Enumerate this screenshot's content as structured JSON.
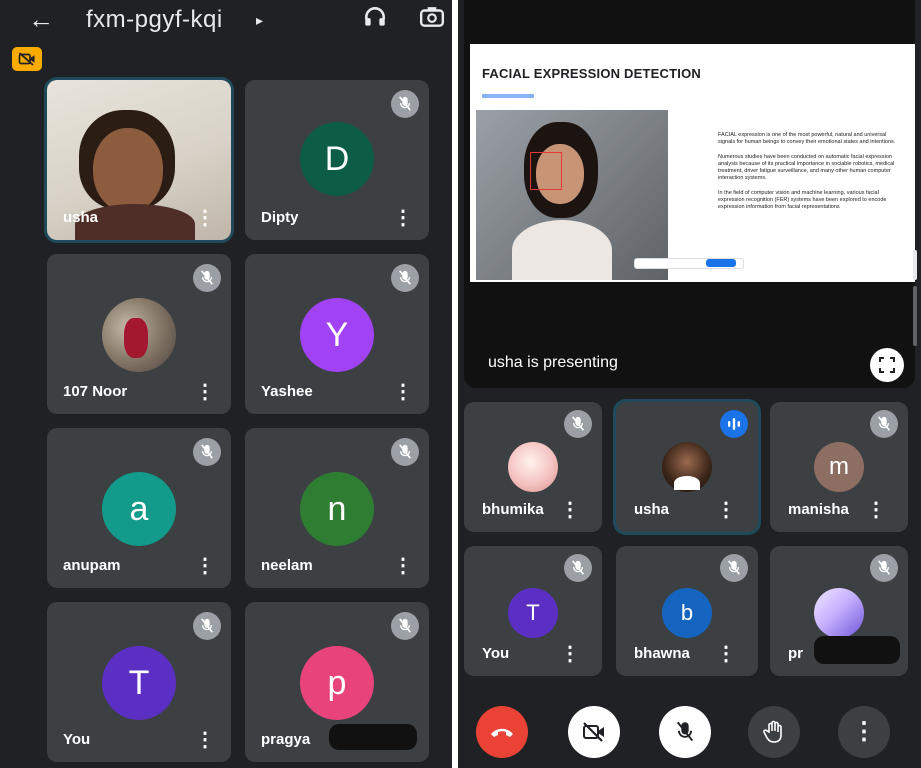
{
  "meeting": {
    "code": "fxm-pgyf-kqi"
  },
  "left_tiles": [
    {
      "name": "usha"
    },
    {
      "name": "Dipty",
      "initial": "D",
      "color": "#0d5c45"
    },
    {
      "name": "107 Noor"
    },
    {
      "name": "Yashee",
      "initial": "Y",
      "color": "#a142f4"
    },
    {
      "name": "anupam",
      "initial": "a",
      "color": "#129b8a"
    },
    {
      "name": "neelam",
      "initial": "n",
      "color": "#2e7d32"
    },
    {
      "name": "You",
      "initial": "T",
      "color": "#5b2fc4"
    },
    {
      "name": "pragya",
      "initial": "p",
      "color": "#e8437a"
    }
  ],
  "presentation": {
    "slide_title": "FACIAL EXPRESSION DETECTION",
    "slide_text_1": "FACIAL expression is one of the most powerful, natural and universal signals for human beings to convey their emotional states and intentions.",
    "slide_text_2": "Numerous studies have been conducted on automatic facial expression analysis because of its practical importance in sociable robotics, medical treatment, driver fatigue surveillance, and many other human computer interaction systems.",
    "slide_text_3": "In the field of computer vision and machine learning, various facial expression recognition (FER) systems have been explored to encode expression information from facial representations",
    "presenting_label": "usha is presenting"
  },
  "right_tiles": [
    {
      "name": "bhumika"
    },
    {
      "name": "usha"
    },
    {
      "name": "manisha",
      "initial": "m",
      "color": "#8d6e63"
    },
    {
      "name": "You",
      "initial": "T",
      "color": "#5b2fc4"
    },
    {
      "name": "bhawna",
      "initial": "b",
      "color": "#1565c0"
    },
    {
      "name": "pr"
    }
  ],
  "colors": {
    "accent": "#8ab4f8",
    "end_call": "#ea4335",
    "background": "#202124",
    "tile": "#3c4043"
  },
  "icons": [
    "back-arrow-icon",
    "headphones-icon",
    "switch-camera-icon",
    "camera-off-icon",
    "mic-off-icon",
    "speaking-icon",
    "fullscreen-icon",
    "end-call-icon",
    "video-off-icon",
    "raise-hand-icon",
    "more-icon"
  ]
}
